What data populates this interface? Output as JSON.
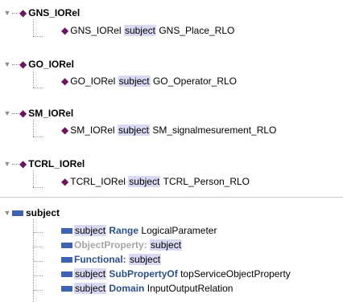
{
  "panels": [
    {
      "title": "GNS_IORel",
      "child": {
        "subject_name": "GNS_IORel",
        "keyword": "subject",
        "object": "GNS_Place_RLO"
      }
    },
    {
      "title": "GO_IORel",
      "child": {
        "subject_name": "GO_IORel",
        "keyword": "subject",
        "object": "GO_Operator_RLO"
      }
    },
    {
      "title": "SM_IORel",
      "child": {
        "subject_name": "SM_IORel",
        "keyword": "subject",
        "object": "SM_signalmesurement_RLO"
      }
    },
    {
      "title": "TCRL_IORel",
      "child": {
        "subject_name": "TCRL_IORel",
        "keyword": "subject",
        "object": "TCRL_Person_RLO"
      }
    }
  ],
  "subject_panel": {
    "title": "subject",
    "rows": [
      {
        "subject": "subject",
        "keyword": "Range",
        "value": "LogicalParameter"
      },
      {
        "prefix": "ObjectProperty:",
        "value": "subject"
      },
      {
        "prefix": "Functional:",
        "value": "subject"
      },
      {
        "subject": "subject",
        "keyword": "SubPropertyOf",
        "value": "topServiceObjectProperty"
      },
      {
        "subject": "subject",
        "keyword": "Domain",
        "value": "InputOutputRelation"
      }
    ]
  }
}
